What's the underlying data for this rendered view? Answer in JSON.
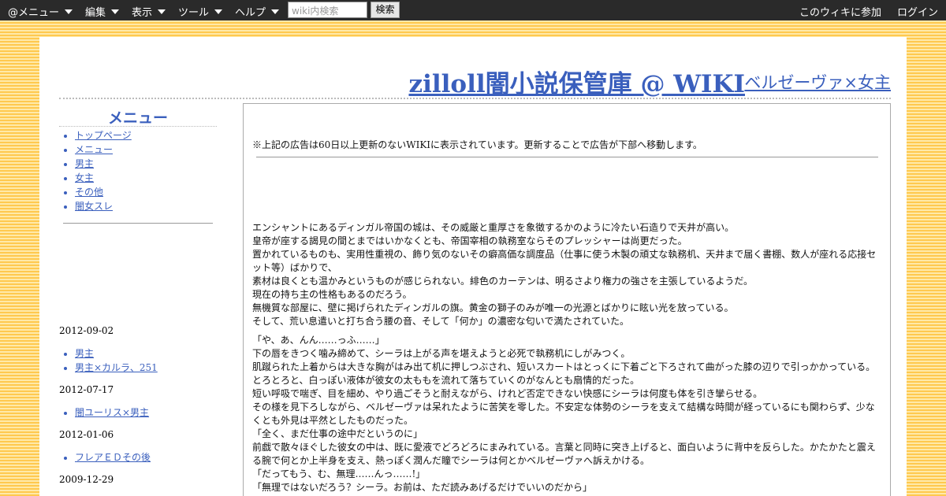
{
  "topbar": {
    "menus": [
      {
        "label": "@メニュー",
        "name": "menu-atwiki"
      },
      {
        "label": "編集",
        "name": "menu-edit"
      },
      {
        "label": "表示",
        "name": "menu-view"
      },
      {
        "label": "ツール",
        "name": "menu-tools"
      },
      {
        "label": "ヘルプ",
        "name": "menu-help"
      }
    ],
    "search_placeholder": "wiki内検索",
    "search_button": "検索",
    "join_link": "このウィキに参加",
    "login_link": "ログイン"
  },
  "header": {
    "site_title": "zilloll闇小説保管庫 @ WIKI",
    "page_title": "ベルゼーヴァ×女主"
  },
  "sidebar": {
    "heading": "メニュー",
    "items": [
      "トップページ",
      "メニュー",
      "男主",
      "女主",
      "その他",
      "闇女スレ"
    ],
    "updates": [
      {
        "date": "2012-09-02",
        "items": [
          "男主",
          "男主×カルラ、251"
        ]
      },
      {
        "date": "2012-07-17",
        "items": [
          "闇ユーリス×男主"
        ]
      },
      {
        "date": "2012-01-06",
        "items": [
          "フレアＥＤその後"
        ]
      },
      {
        "date": "2009-12-29",
        "items": []
      }
    ]
  },
  "main": {
    "ad_note": "※上記の広告は60日以上更新のないWIKIに表示されています。更新することで広告が下部へ移動します。",
    "para1": [
      "エンシャントにあるディンガル帝国の城は、その威厳と重厚さを象徴するかのように冷たい石造りで天井が高い。",
      "皇帝が座する謁見の間とまではいかなくとも、帝国宰相の執務室ならそのプレッシャーは尚更だった。",
      "置かれているものも、実用性重視の、飾り気のないその癖高価な調度品（仕事に使う木製の頑丈な執務机、天井まで届く書棚、数人が座れる応接セット等）ばかりで、",
      "素材は良くとも温かみというものが感じられない。緋色のカーテンは、明るさより権力の強さを主張しているようだ。",
      "現在の持ち主の性格もあるのだろう。",
      "無機質な部屋に、壁に掲げられたディンガルの旗。黄金の獅子のみが唯一の光源とばかりに眩い光を放っている。",
      "そして、荒い息遣いと打ち合う腰の音、そして「何か」の濃密な匂いで満たされていた。"
    ],
    "para2": [
      "「や、あ、んん……っふ……」",
      "下の唇をきつく噛み締めて、シーラは上がる声を堪えようと必死で執務机にしがみつく。",
      "肌蹴られた上着からは大きな胸がはみ出て机に押しつぶされ、短いスカートはとっくに下着ごと下ろされて曲がった膝の辺りで引っかかっている。",
      "とろとろと、白っぽい液体が彼女の太ももを流れて落ちていくのがなんとも扇情的だった。",
      "短い呼吸で喘ぎ、目を細め、やり過ごそうと耐えながら、けれど否定できない快感にシーラは何度も体を引き攣らせる。",
      "その様を見下ろしながら、ベルゼーヴァは呆れたように苦笑を零した。不安定な体勢のシーラを支えて結構な時間が経っているにも関わらず、少なくとも外見は平然としたものだった。",
      "「全く、まだ仕事の途中だというのに」",
      "前戯で散々ほぐした彼女の中は、既に愛液でどろどろにまみれている。言葉と同時に突き上げると、面白いように背中を反らした。かたかたと震える腕で何とか上半身を支え、熱っぽく潤んだ瞳でシーラは何とかベルゼーヴァへ訴えかける。",
      "「だってもう、む、無理……んっ……!」",
      "「無理ではないだろう？シーラ。お前は、ただ読みあげるだけでいいのだから」"
    ]
  }
}
